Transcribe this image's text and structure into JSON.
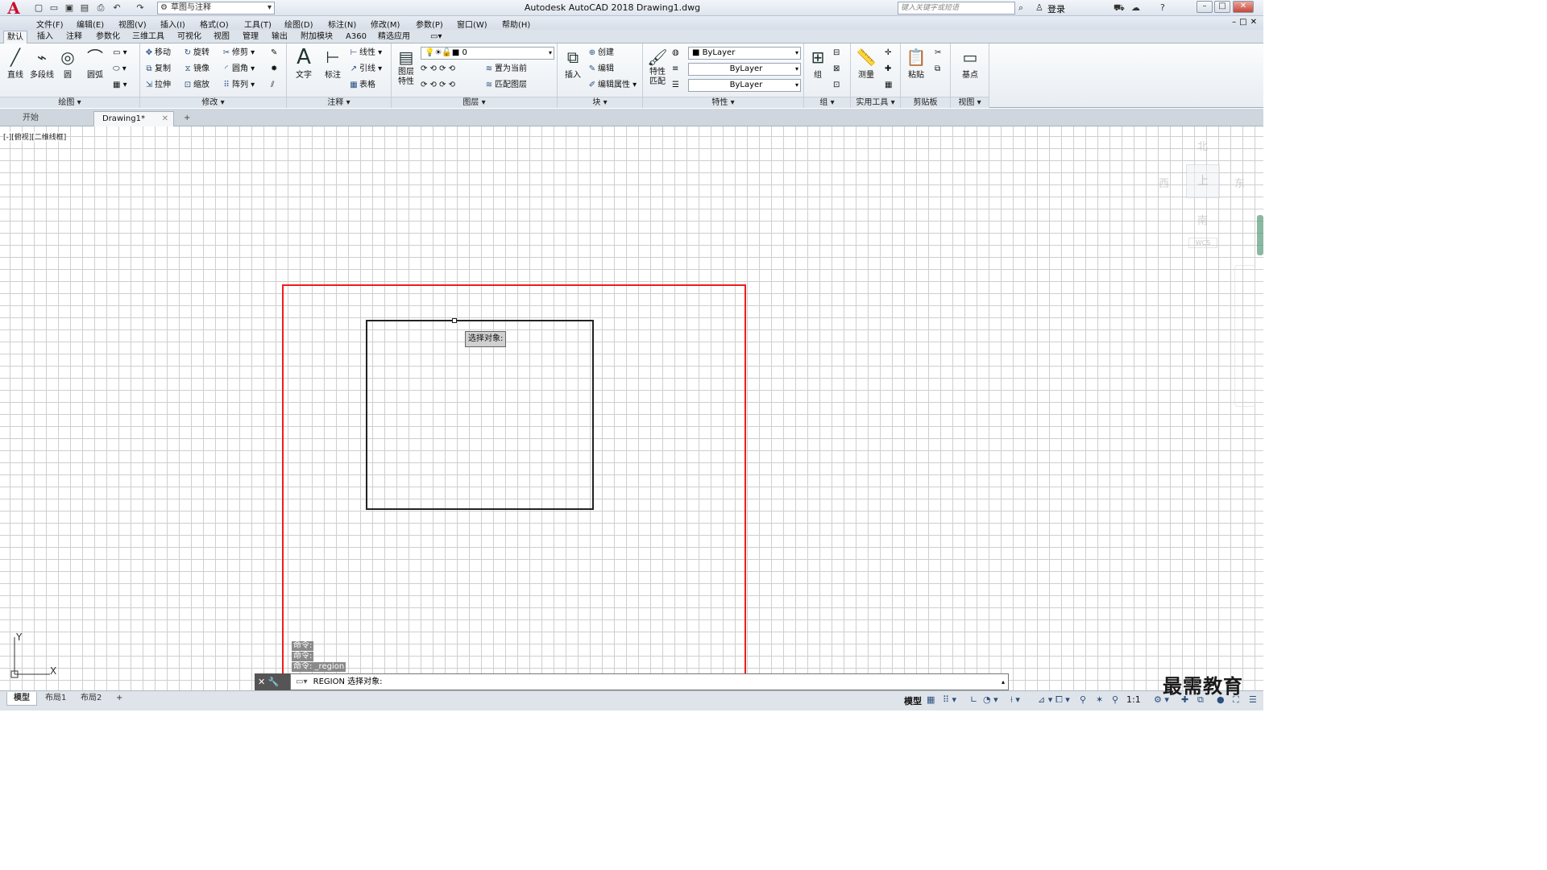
{
  "app": {
    "logo_letter": "A",
    "window_title": "Autodesk AutoCAD 2018    Drawing1.dwg",
    "workspace": "草图与注释",
    "search_placeholder": "键入关键字或短语",
    "login": "登录"
  },
  "menu": [
    "文件(F)",
    "编辑(E)",
    "视图(V)",
    "插入(I)",
    "格式(O)",
    "工具(T)",
    "绘图(D)",
    "标注(N)",
    "修改(M)",
    "参数(P)",
    "窗口(W)",
    "帮助(H)"
  ],
  "ribbon_tabs": [
    "默认",
    "插入",
    "注释",
    "参数化",
    "三维工具",
    "可视化",
    "视图",
    "管理",
    "输出",
    "附加模块",
    "A360",
    "精选应用"
  ],
  "ribbon": {
    "draw": {
      "title": "绘图",
      "line": "直线",
      "polyline": "多段线",
      "circle": "圆",
      "arc": "圆弧"
    },
    "modify": {
      "title": "修改",
      "move": "移动",
      "rotate": "旋转",
      "trim": "修剪",
      "copy": "复制",
      "mirror": "镜像",
      "fillet": "圆角",
      "stretch": "拉伸",
      "scale": "缩放",
      "array": "阵列"
    },
    "annotation": {
      "title": "注释",
      "text": "文字",
      "dimension": "标注",
      "linear": "线性",
      "leader": "引线",
      "table": "表格"
    },
    "layers": {
      "title": "图层",
      "layer_props": "图层特性",
      "current_layer": "0",
      "set_current": "置为当前",
      "match_layer": "匹配图层"
    },
    "block": {
      "title": "块",
      "insert": "插入",
      "create": "创建",
      "edit": "编辑",
      "edit_attr": "编辑属性"
    },
    "properties": {
      "title": "特性",
      "match": "特性匹配",
      "color": "ByLayer",
      "linetype": "ByLayer",
      "lineweight": "ByLayer"
    },
    "groups": {
      "title": "组",
      "group": "组"
    },
    "utilities": {
      "title": "实用工具",
      "measure": "测量"
    },
    "clipboard": {
      "title": "剪贴板",
      "paste": "粘贴"
    },
    "view": {
      "title": "视图",
      "base": "基点"
    }
  },
  "doc_tabs": {
    "start": "开始",
    "drawing": "Drawing1*"
  },
  "canvas": {
    "viewport_label": "[-][俯视][二维线框]",
    "tooltip": "选择对象:",
    "viewcube": {
      "north": "北",
      "south": "南",
      "east": "东",
      "west": "西",
      "top": "上",
      "wcs": "WCS"
    },
    "ucs_x": "X",
    "ucs_y": "Y"
  },
  "command_history": [
    "命令:",
    "命令:",
    "命令: _region"
  ],
  "command_line": "REGION 选择对象:",
  "layout_tabs": [
    "模型",
    "布局1",
    "布局2"
  ],
  "status": {
    "model": "模型",
    "scale": "1:1"
  },
  "watermark": "最需教育",
  "colors": {
    "highlight": "#ee1c1c",
    "accent": "#c8102e"
  }
}
